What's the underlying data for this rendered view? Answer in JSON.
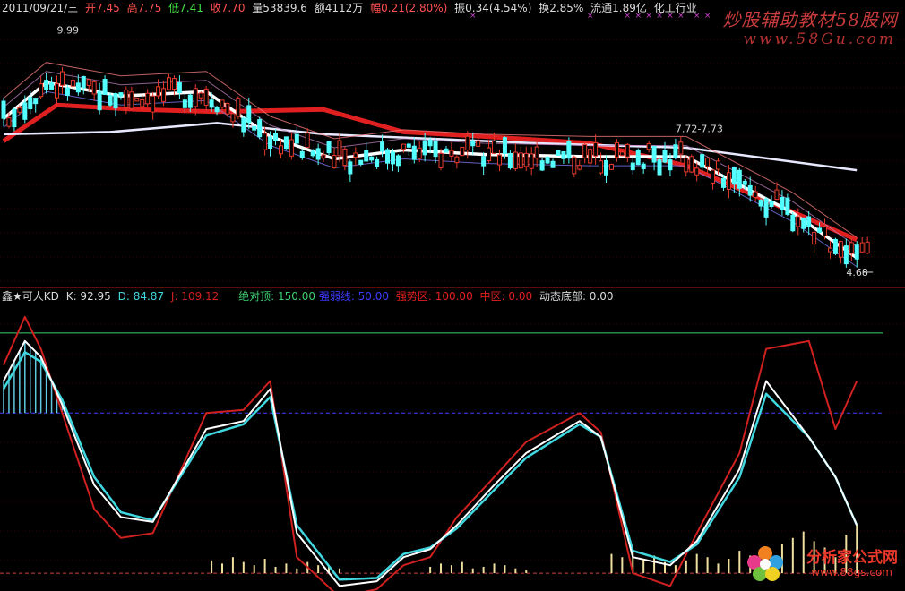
{
  "header": {
    "date": "2011/09/21/三",
    "open": "开7.45",
    "high": "高7.75",
    "low": "低7.41",
    "close": "收7.70",
    "volume": "量53839.6",
    "amount": "额4112万",
    "change": "幅0.21(2.80%)",
    "amplitude": "振0.34(4.54%)",
    "turnover": "换2.85%",
    "float_shares": "流通1.89亿",
    "industry": "化工行业"
  },
  "indicator_header": {
    "name": "鑫★可人KD",
    "k": "K: 92.95",
    "d": "D: 84.87",
    "j": "J: 109.12",
    "abs_top": "绝对顶: 150.00",
    "strength_line": "强弱线: 50.00",
    "strong_zone": "强势区: 100.00",
    "mid_zone": "中区: 0.00",
    "dyn_bottom": "动态底部: 0.00"
  },
  "watermarks": {
    "top_title": "炒股辅助教材58股网",
    "top_url": "www.58Gu.com",
    "bottom_title": "分析家公式网",
    "bottom_url": "www.88gs.com"
  },
  "colors": {
    "background": "#000000",
    "up": "#e8392b",
    "down": "#54ffff",
    "white_line": "#ffffff",
    "ma_red": "#e02020",
    "k_line": "#ffffff",
    "d_line": "#40d8e0",
    "j_line": "#d02020",
    "abs_top_line": "#3cd070",
    "strength_line": "#3c3cff",
    "zero_line": "#d04040"
  },
  "chart_data": [
    {
      "type": "candlestick",
      "title": "",
      "x_range": [
        0,
        165
      ],
      "ylim": [
        4.4,
        10.3
      ],
      "price_labels": [
        "9.99",
        "7.72-7.73",
        "4.68"
      ],
      "marker_label": "×",
      "trend_note": "price declines from 9.99 high to 4.68 low",
      "ma_series": [
        {
          "name": "",
          "x": [
            0,
            10,
            25,
            40,
            60,
            75,
            90,
            110,
            128,
            160
          ],
          "values": [
            7.6,
            8.4,
            8.3,
            8.25,
            8.3,
            7.8,
            7.7,
            7.55,
            7.05,
            5.4
          ]
        },
        {
          "name": "",
          "x": [
            0,
            8,
            22,
            38,
            50,
            62,
            75,
            90,
            110,
            128,
            148,
            160
          ],
          "values": [
            8.1,
            8.9,
            8.6,
            8.7,
            7.7,
            7.2,
            7.4,
            7.3,
            7.25,
            7.25,
            6.0,
            5.0
          ]
        },
        {
          "name": "",
          "x": [
            0,
            20,
            40,
            60,
            80,
            100,
            128,
            160
          ],
          "values": [
            7.75,
            7.8,
            8.0,
            7.75,
            7.65,
            7.55,
            7.45,
            6.95
          ]
        }
      ]
    },
    {
      "type": "line",
      "title": "",
      "ylim": [
        -10,
        165
      ],
      "hlines": [
        150,
        100,
        0
      ],
      "series": [
        {
          "name": "K",
          "x": [
            0,
            4,
            7,
            11,
            17,
            22,
            28,
            38,
            45,
            50,
            55,
            63,
            70,
            75,
            80,
            85,
            92,
            98,
            108,
            112,
            118,
            125,
            130,
            138,
            143,
            151,
            156,
            160
          ],
          "values": [
            120,
            145,
            135,
            105,
            55,
            35,
            32,
            90,
            95,
            115,
            25,
            -8,
            -5,
            10,
            15,
            30,
            55,
            75,
            95,
            85,
            10,
            5,
            20,
            65,
            120,
            85,
            60,
            30
          ]
        },
        {
          "name": "D",
          "x": [
            0,
            4,
            7,
            11,
            17,
            22,
            28,
            38,
            45,
            50,
            55,
            63,
            70,
            75,
            80,
            85,
            92,
            98,
            108,
            112,
            118,
            125,
            130,
            138,
            143,
            151,
            156,
            160
          ],
          "values": [
            115,
            138,
            132,
            108,
            60,
            38,
            33,
            86,
            93,
            110,
            30,
            -4,
            -3,
            12,
            16,
            28,
            52,
            72,
            93,
            85,
            14,
            7,
            18,
            60,
            112,
            85,
            60,
            30
          ]
        },
        {
          "name": "J",
          "x": [
            0,
            4,
            7,
            11,
            17,
            22,
            28,
            38,
            45,
            50,
            55,
            63,
            70,
            75,
            80,
            85,
            92,
            98,
            108,
            112,
            118,
            125,
            130,
            138,
            143,
            151,
            156,
            160
          ],
          "values": [
            130,
            160,
            140,
            100,
            40,
            22,
            25,
            100,
            102,
            120,
            10,
            -15,
            -10,
            5,
            10,
            35,
            60,
            82,
            100,
            88,
            0,
            -8,
            25,
            75,
            140,
            145,
            90,
            120
          ]
        }
      ],
      "bars_x": [
        39,
        41,
        43,
        45,
        47,
        49,
        51,
        53,
        55,
        57,
        59,
        61,
        63,
        80,
        82,
        84,
        86,
        88,
        90,
        92,
        94,
        96,
        98,
        114,
        116,
        118,
        120,
        122,
        124,
        126,
        128,
        130,
        132,
        134,
        136,
        138,
        140,
        142,
        144,
        146,
        148,
        150,
        152,
        154,
        156,
        158,
        160
      ],
      "bars_values": [
        8,
        6,
        10,
        7,
        5,
        9,
        4,
        6,
        3,
        7,
        5,
        4,
        3,
        4,
        6,
        5,
        7,
        3,
        4,
        6,
        5,
        3,
        2,
        12,
        10,
        14,
        9,
        11,
        7,
        5,
        8,
        12,
        10,
        6,
        9,
        14,
        11,
        8,
        6,
        18,
        22,
        26,
        20,
        16,
        10,
        24,
        30
      ]
    }
  ]
}
